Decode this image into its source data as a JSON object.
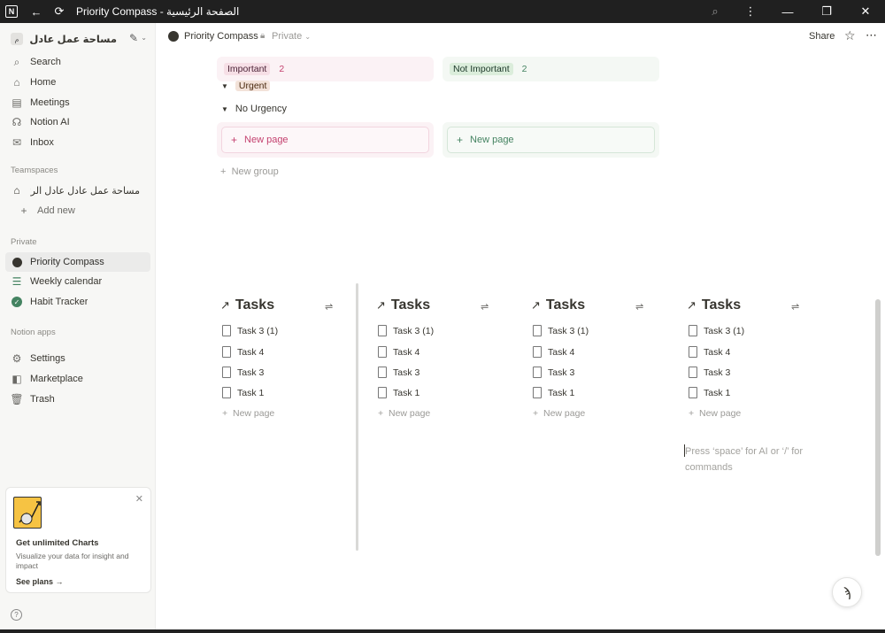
{
  "window": {
    "title": "Priority Compass - الصفحة الرئيسية",
    "controls": {
      "minimize": "—",
      "maximize": "❐",
      "close": "✕"
    }
  },
  "workspace": {
    "avatar": "م",
    "name": "مساحة عمل عادل ع..."
  },
  "nav": {
    "search": "Search",
    "home": "Home",
    "meetings": "Meetings",
    "notion_ai": "Notion AI",
    "inbox": "Inbox"
  },
  "teamspaces": {
    "label": "Teamspaces",
    "items": [
      {
        "label": "مساحة عمل عادل عادل الرئيسي"
      }
    ],
    "add_new": "Add new"
  },
  "private": {
    "label": "Private",
    "items": [
      {
        "label": "Priority Compass",
        "icon": "compass-icon",
        "active": true
      },
      {
        "label": "Weekly calendar",
        "icon": "checklist-icon"
      },
      {
        "label": "Habit Tracker",
        "icon": "check-badge-icon"
      }
    ]
  },
  "notion_apps": {
    "label": "Notion apps",
    "settings": "Settings",
    "marketplace": "Marketplace",
    "trash": "Trash"
  },
  "promo": {
    "title": "Get unlimited Charts",
    "description": "Visualize your data for insight and impact",
    "link": "See plans"
  },
  "topbar": {
    "page_title": "Priority Compass",
    "visibility": "Private",
    "share": "Share"
  },
  "board": {
    "columns": [
      {
        "tag": "Important",
        "count": "2",
        "tag_bg": "#f6dfe6",
        "tag_color": "#4c2337",
        "count_color": "#c4416f",
        "bg": "#fbf2f5"
      },
      {
        "tag": "Not Important",
        "count": "2",
        "tag_bg": "#dbeddb",
        "tag_color": "#1c3829",
        "count_color": "#448361",
        "bg": "#f4f8f4"
      }
    ],
    "groups": [
      {
        "label": "Urgent",
        "tagged": true
      },
      {
        "label": "No Urgency",
        "tagged": false
      }
    ],
    "new_page": "New page",
    "new_group": "New group"
  },
  "task_lists": [
    {
      "title": "Tasks",
      "items": [
        "Task 3 (1)",
        "Task 4",
        "Task 3",
        "Task 1"
      ],
      "new_page": "New page"
    },
    {
      "title": "Tasks",
      "items": [
        "Task 3 (1)",
        "Task 4",
        "Task 3",
        "Task 1"
      ],
      "new_page": "New page"
    },
    {
      "title": "Tasks",
      "items": [
        "Task 3 (1)",
        "Task 4",
        "Task 3",
        "Task 1"
      ],
      "new_page": "New page"
    },
    {
      "title": "Tasks",
      "items": [
        "Task 3 (1)",
        "Task 4",
        "Task 3",
        "Task 1"
      ],
      "new_page": "New page"
    }
  ],
  "editor": {
    "placeholder": "Press ‘space’ for AI or ‘/’ for commands"
  }
}
